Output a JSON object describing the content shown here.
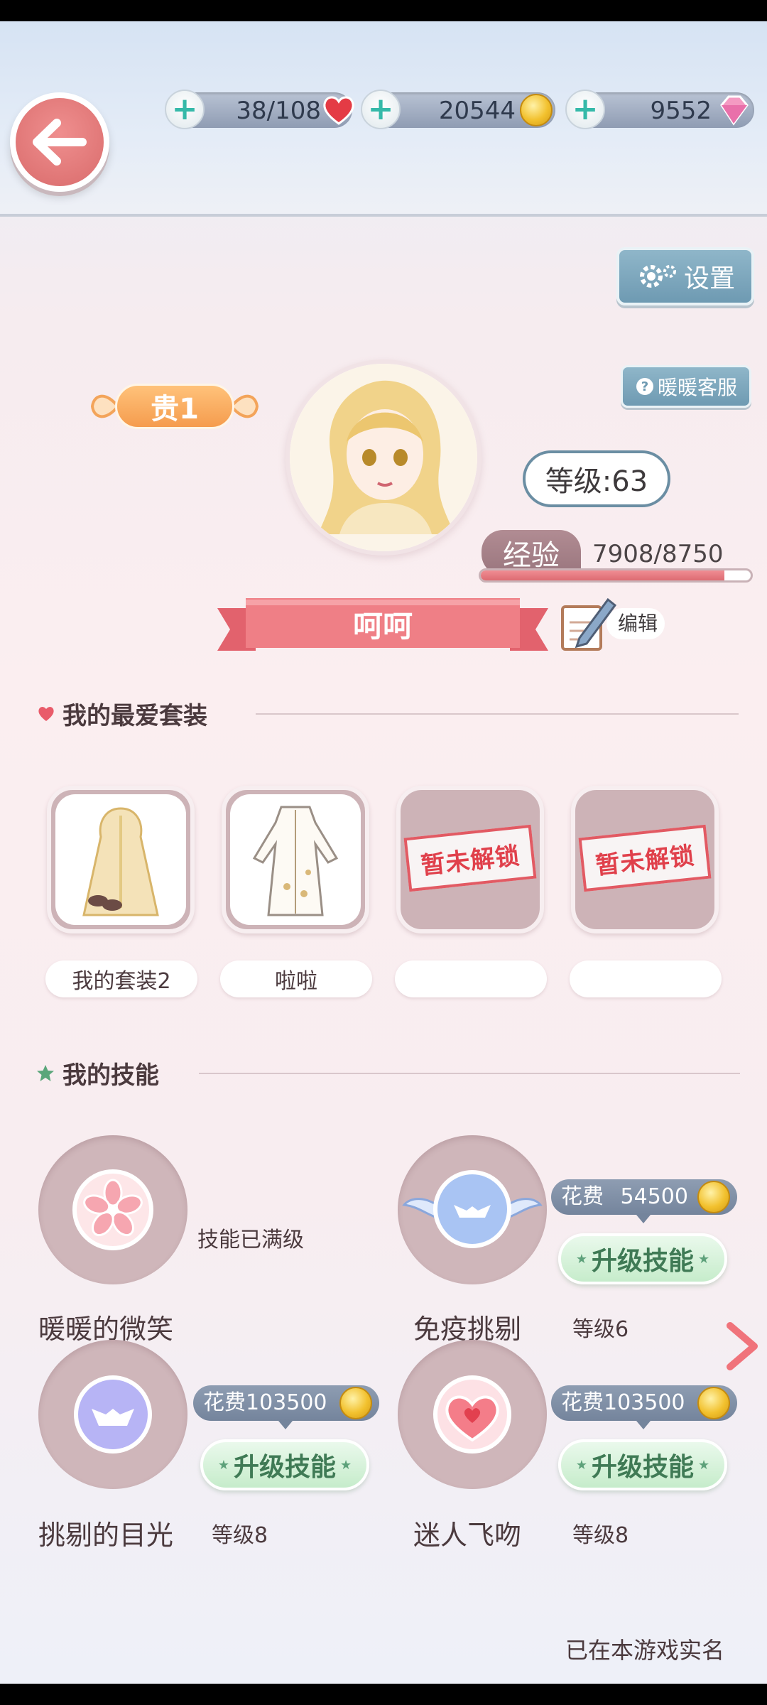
{
  "resources": {
    "stamina": "38/108",
    "gold": "20544",
    "diamonds": "9552"
  },
  "header": {
    "settings_label": "设置",
    "service_label": "暖暖客服"
  },
  "profile": {
    "vip_label": "贵1",
    "level_label": "等级:63",
    "exp_label": "经验",
    "exp_value": "7908/8750",
    "exp_fraction": 0.9037,
    "name": "呵呵",
    "edit_label": "编辑"
  },
  "favorites": {
    "title": "我的最爱套装",
    "outfits": [
      {
        "name": "我的套装2",
        "locked": false
      },
      {
        "name": "啦啦",
        "locked": false
      },
      {
        "name": "",
        "locked": true,
        "stamp": "暂未解锁"
      },
      {
        "name": "",
        "locked": true,
        "stamp": "暂未解锁"
      }
    ]
  },
  "skills": {
    "title": "我的技能",
    "cost_prefix": "花费",
    "upgrade_label": "升级技能",
    "items": [
      {
        "name": "暖暖的微笑",
        "note": "技能已满级"
      },
      {
        "name": "免疫挑剔",
        "cost": "54500",
        "level": "等级6"
      },
      {
        "name": "挑剔的目光",
        "cost": "103500",
        "level": "等级8"
      },
      {
        "name": "迷人飞吻",
        "cost": "103500",
        "level": "等级8"
      }
    ]
  },
  "footer": {
    "realname_label": "已在本游戏实名"
  },
  "colors": {
    "accent_pink": "#e07676",
    "exp_fill": "#dd6b72",
    "teal_plus": "#35b9a9",
    "upgrade_green": "#c6eccb",
    "slate_button": "#6e9ab2"
  }
}
